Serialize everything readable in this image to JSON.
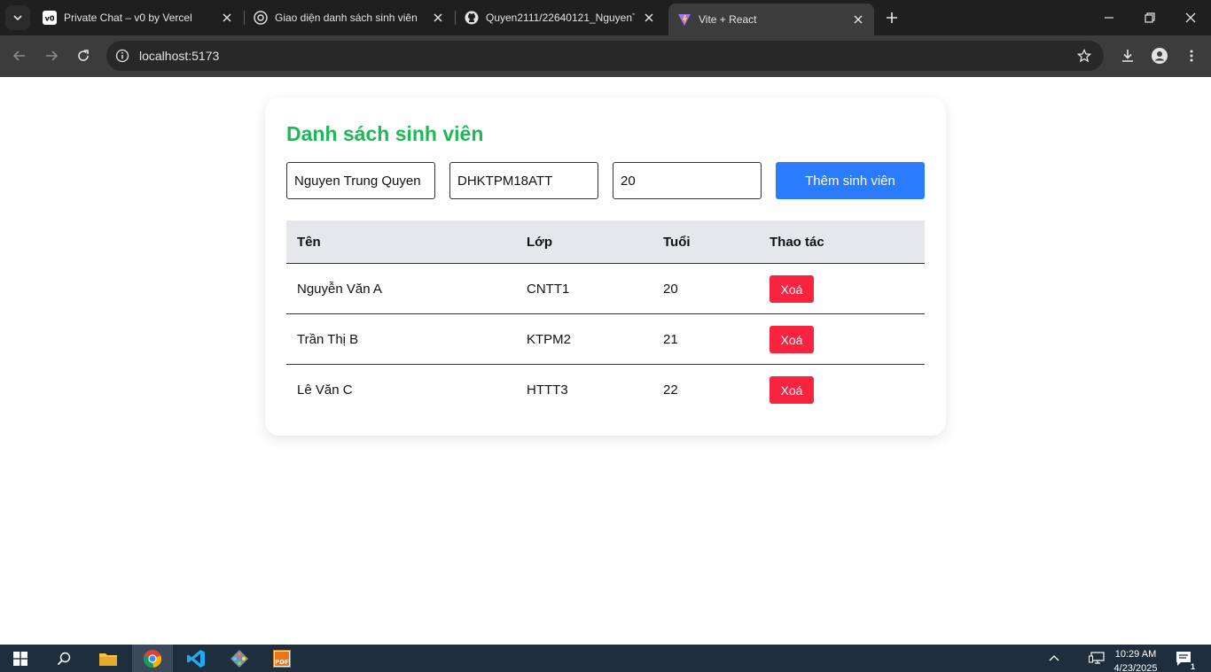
{
  "browser": {
    "tabs": [
      {
        "title": "Private Chat – v0 by Vercel",
        "favicon": "v0-icon"
      },
      {
        "title": "Giao diện danh sách sinh viên",
        "favicon": "chatgpt-icon"
      },
      {
        "title": "Quyen2111/22640121_NguyenT",
        "favicon": "github-icon"
      },
      {
        "title": "Vite + React",
        "favicon": "vite-icon",
        "active": true
      }
    ],
    "url": "localhost:5173"
  },
  "page": {
    "heading": "Danh sách sinh viên",
    "form": {
      "name_value": "Nguyen Trung Quyen",
      "class_value": "DHKTPM18ATT",
      "age_value": "20",
      "add_label": "Thêm sinh viên"
    },
    "table": {
      "headers": {
        "name": "Tên",
        "class": "Lớp",
        "age": "Tuổi",
        "actions": "Thao tác"
      },
      "rows": [
        {
          "name": "Nguyễn Văn A",
          "class": "CNTT1",
          "age": "20",
          "action": "Xoá"
        },
        {
          "name": "Trần Thị B",
          "class": "KTPM2",
          "age": "21",
          "action": "Xoá"
        },
        {
          "name": "Lê Văn C",
          "class": "HTTT3",
          "age": "22",
          "action": "Xoá"
        }
      ]
    }
  },
  "taskbar": {
    "time": "10:29 AM",
    "date": "4/23/2025",
    "notification_count": "1"
  },
  "colors": {
    "heading": "#1eb854",
    "add_button": "#2b7bff",
    "delete_button": "#f8233f"
  }
}
